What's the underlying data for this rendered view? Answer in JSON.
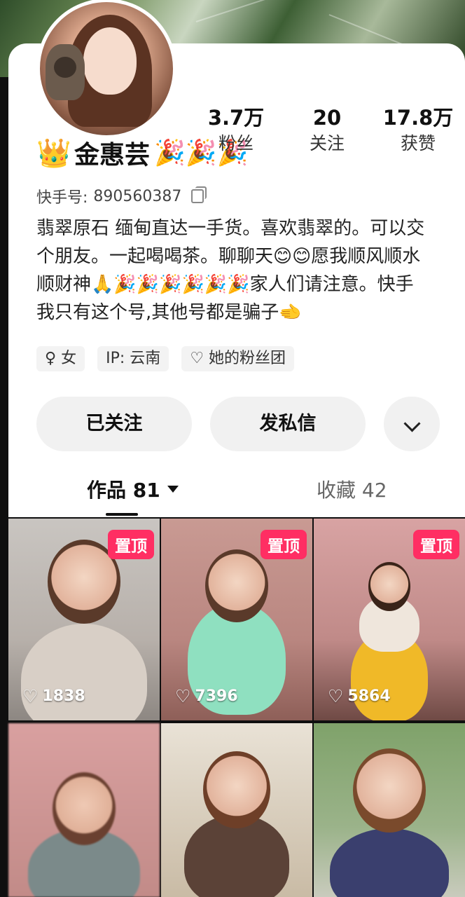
{
  "profile": {
    "name": "金惠芸",
    "crown_icon": "👑",
    "party_icons": "🎉🎉🎉",
    "id_label": "快手号:",
    "id_value": "890560387",
    "bio": "翡翠原石 缅甸直达一手货。喜欢翡翠的。可以交个朋友。一起喝喝茶。聊聊天😊😊愿我顺风顺水顺财神🙏🎉🎉🎉🎉🎉🎉家人们请注意。快手我只有这个号,其他号都是骗子🫲",
    "stats": [
      {
        "value": "3.7万",
        "label": "粉丝"
      },
      {
        "value": "20",
        "label": "关注"
      },
      {
        "value": "17.8万",
        "label": "获赞"
      }
    ],
    "tags": [
      {
        "icon": "♀",
        "text": "女"
      },
      {
        "icon": "",
        "text": "IP: 云南"
      },
      {
        "icon": "♡",
        "text": "她的粉丝团"
      }
    ]
  },
  "actions": {
    "follow_label": "已关注",
    "message_label": "发私信",
    "more_icon": "chevron-down-icon"
  },
  "tabs": {
    "works_label": "作品 81",
    "collect_label": "收藏 42"
  },
  "grid": {
    "pin_label": "置顶",
    "items": [
      {
        "likes": "1838",
        "pinned": true
      },
      {
        "likes": "7396",
        "pinned": true
      },
      {
        "likes": "5864",
        "pinned": true
      },
      {
        "likes": "",
        "pinned": false
      },
      {
        "likes": "",
        "pinned": false
      },
      {
        "likes": "",
        "pinned": false
      }
    ]
  },
  "colors": {
    "pin_badge": "#ff2e63",
    "button_bg": "#f1f1f1",
    "card_bg": "#ffffff"
  }
}
